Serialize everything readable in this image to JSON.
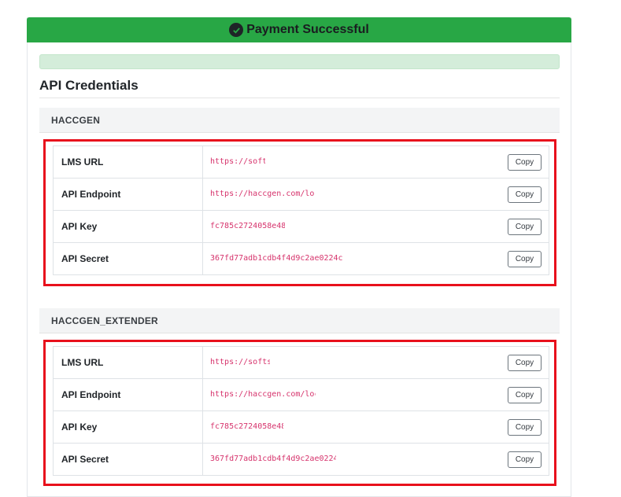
{
  "banner": {
    "title": "Payment Successful",
    "icon": "check-circle-icon"
  },
  "section_title": "API Credentials",
  "groups": [
    {
      "name": "HACCGEN",
      "rows": [
        {
          "label": "LMS URL",
          "value": "https://soft",
          "copy": "Copy"
        },
        {
          "label": "API Endpoint",
          "value": "https://haccgen.com/lo",
          "copy": "Copy"
        },
        {
          "label": "API Key",
          "value": "fc785c2724058e48",
          "copy": "Copy"
        },
        {
          "label": "API Secret",
          "value": "367fd77adb1cdb4f4d9c2ae0224c",
          "copy": "Copy"
        }
      ]
    },
    {
      "name": "HACCGEN_EXTENDER",
      "rows": [
        {
          "label": "LMS URL",
          "value": "https://softs",
          "copy": "Copy"
        },
        {
          "label": "API Endpoint",
          "value": "https://haccgen.com/loc",
          "copy": "Copy"
        },
        {
          "label": "API Key",
          "value": "fc785c2724058e48",
          "copy": "Copy"
        },
        {
          "label": "API Secret",
          "value": "367fd77adb1cdb4f4d9c2ae0224",
          "copy": "Copy"
        }
      ]
    }
  ],
  "colors": {
    "success": "#28a745",
    "highlight": "#e8101c",
    "code": "#d6336c"
  }
}
